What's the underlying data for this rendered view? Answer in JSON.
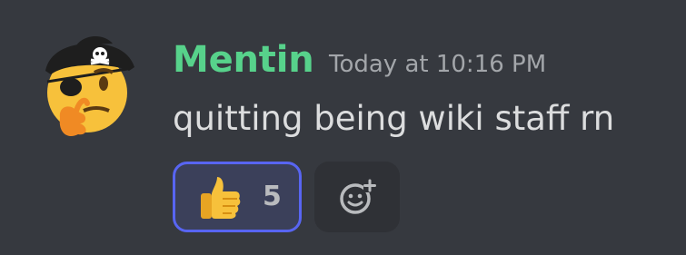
{
  "message": {
    "author": "Mentin",
    "timestamp": "Today at 10:16 PM",
    "content": "quitting being wiki staff rn",
    "author_color": "#57d28b",
    "avatar_icon": "thinking-pirate-emoji-icon",
    "reactions": [
      {
        "emoji_icon": "thumbs-up-icon",
        "count": "5",
        "active": true,
        "accent": "#5865f2"
      }
    ],
    "add_reaction_icon": "add-reaction-icon"
  }
}
